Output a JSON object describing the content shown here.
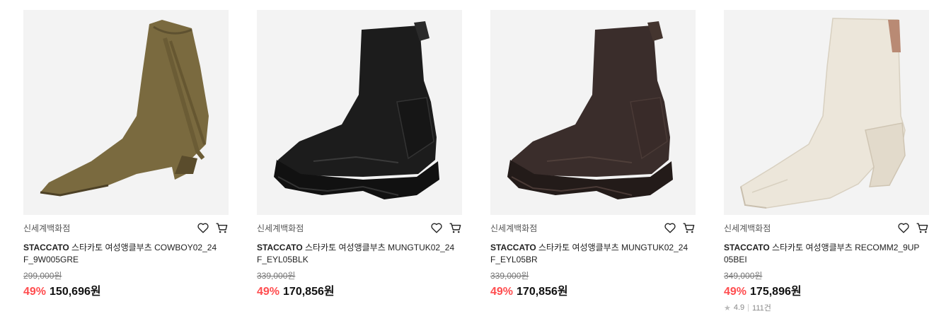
{
  "products": [
    {
      "store": "신세계백화점",
      "brand": "STACCATO",
      "title": "스타카토 여성앵클부츠 COWBOY02_24F_9W005GRE",
      "original_price": "299,000원",
      "discount": "49%",
      "price": "150,696원",
      "image_icon": "suede-fringe-ankle-boot",
      "image_color": "#7a6a3f"
    },
    {
      "store": "신세계백화점",
      "brand": "STACCATO",
      "title": "스타카토 여성앵클부츠 MUNGTUK02_24F_EYL05BLK",
      "original_price": "339,000원",
      "discount": "49%",
      "price": "170,856원",
      "image_icon": "sock-chunky-sneaker-boot",
      "image_color": "#1c1c1c"
    },
    {
      "store": "신세계백화점",
      "brand": "STACCATO",
      "title": "스타카토 여성앵클부츠 MUNGTUK02_24F_EYL05BR",
      "original_price": "339,000원",
      "discount": "49%",
      "price": "170,856원",
      "image_icon": "sock-chunky-sneaker-boot",
      "image_color": "#3a2d2b"
    },
    {
      "store": "신세계백화점",
      "brand": "STACCATO",
      "title": "스타카토 여성앵클부츠 RECOMM2_9UP05BEI",
      "original_price": "349,000원",
      "discount": "49%",
      "price": "175,896원",
      "rating": "4.9",
      "review_count": "111건",
      "image_icon": "square-toe-block-heel-boot",
      "image_color": "#ece6da"
    }
  ],
  "colors": {
    "discount": "#ff4d4f",
    "image_bg": "#f3f3f3"
  },
  "icons": {
    "wishlist": "heart-icon",
    "cart": "cart-icon",
    "rating": "star-icon"
  }
}
